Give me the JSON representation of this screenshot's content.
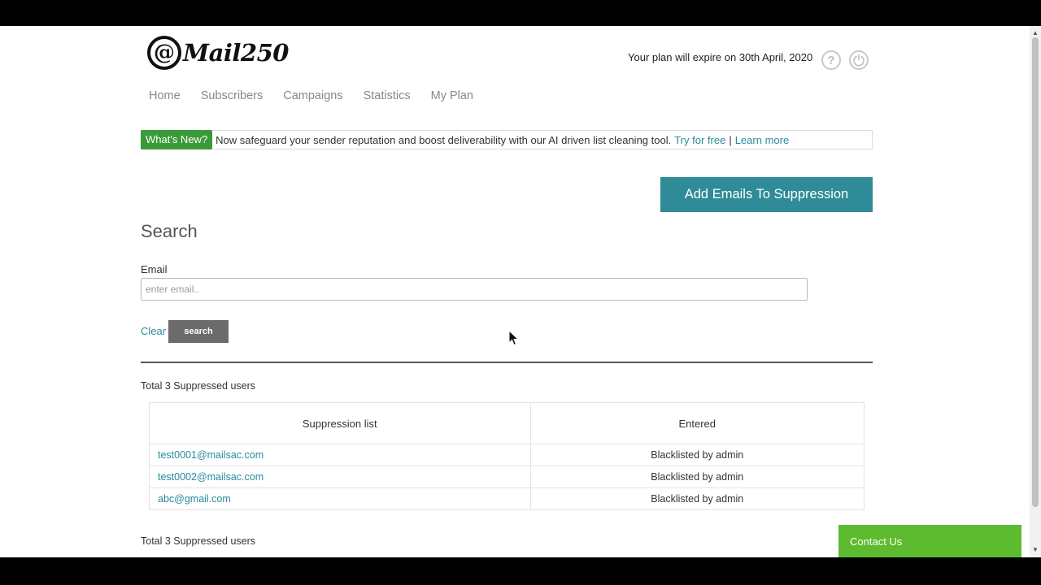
{
  "header": {
    "logo_at": "@",
    "logo_text": "Mail250",
    "plan_text": "Your plan will expire on 30th April, 2020"
  },
  "nav": {
    "items": [
      "Home",
      "Subscribers",
      "Campaigns",
      "Statistics",
      "My Plan"
    ]
  },
  "news": {
    "badge": "What's New?",
    "text": "Now safeguard your sender reputation and boost deliverability with our AI driven list cleaning tool.",
    "try_link": "Try for free",
    "separator": "|",
    "learn_link": "Learn more"
  },
  "actions": {
    "add_button": "Add Emails To Suppression"
  },
  "search": {
    "title": "Search",
    "email_label": "Email",
    "email_placeholder": "enter email..",
    "email_value": "",
    "clear_label": "Clear",
    "search_label": "search"
  },
  "results": {
    "total_top": "Total 3 Suppressed users",
    "total_bottom": "Total 3 Suppressed users",
    "columns": [
      "Suppression list",
      "Entered"
    ],
    "rows": [
      {
        "email": "test0001@mailsac.com",
        "entered": "Blacklisted by admin"
      },
      {
        "email": "test0002@mailsac.com",
        "entered": "Blacklisted by admin"
      },
      {
        "email": "abc@gmail.com",
        "entered": "Blacklisted by admin"
      }
    ]
  },
  "contact": {
    "label": "Contact Us"
  },
  "icons": {
    "help": "question-circle-icon",
    "power": "power-icon"
  },
  "colors": {
    "accent": "#2e8b97",
    "link": "#2a8a9a",
    "badge_green": "#3a9a3a",
    "contact_green": "#5dbb2f"
  }
}
